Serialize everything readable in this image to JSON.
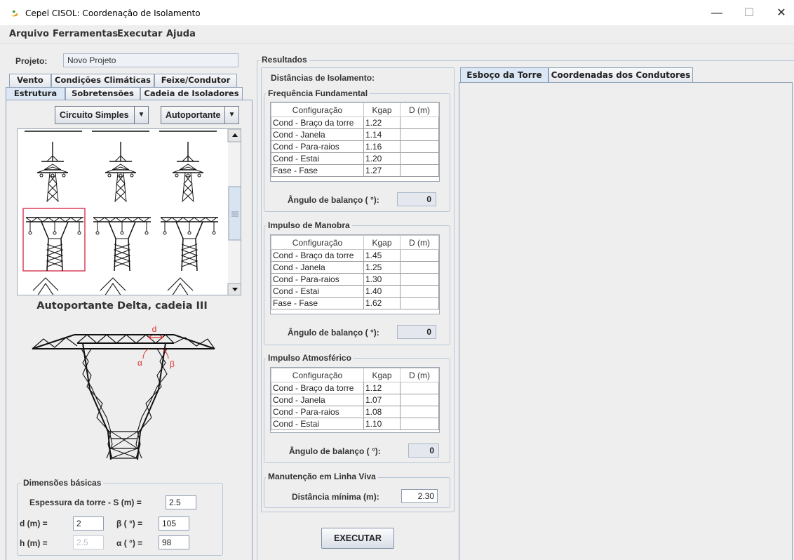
{
  "window": {
    "title": "Cepel CISOL: Coordenação de Isolamento",
    "minimize": "—",
    "maximize": "☐",
    "close": "✕"
  },
  "menu": [
    "Arquivo",
    "Ferramentas",
    "Executar",
    "Ajuda"
  ],
  "project": {
    "label": "Projeto:",
    "value": "Novo Projeto"
  },
  "left_tabs": {
    "row1": [
      "Vento",
      "Condições Climáticas",
      "Feixe/Condutor"
    ],
    "row2": [
      "Estrutura",
      "Sobretensões",
      "Cadeia de Isoladores"
    ],
    "active": "Estrutura"
  },
  "combos": {
    "circuit": "Circuito Simples",
    "type": "Autoportante"
  },
  "selected_structure": "Autoportante Delta, cadeia III",
  "diagram_labels": {
    "d": "d",
    "alpha": "α",
    "beta": "β"
  },
  "dims": {
    "title": "Dimensões básicas",
    "thickness_label": "Espessura da torre - S (m) =",
    "thickness_value": "2.5",
    "d_label": "d (m) =",
    "d_value": "2",
    "beta_label": "β ( °) =",
    "beta_value": "105",
    "h_label": "h (m) =",
    "h_value": "2.5",
    "alpha_label": "α ( °) =",
    "alpha_value": "98"
  },
  "results": {
    "title": "Resultados",
    "subtitle": "Distâncias de Isolamento:",
    "headers": [
      "Configuração",
      "Kgap",
      "D (m)"
    ],
    "angle_label": "Ângulo de balanço ( °):",
    "freq": {
      "title": "Frequência Fundamental",
      "rows": [
        [
          "Cond - Braço da torre",
          "1.22",
          ""
        ],
        [
          "Cond - Janela",
          "1.14",
          ""
        ],
        [
          "Cond - Para-raios",
          "1.16",
          ""
        ],
        [
          "Cond - Estai",
          "1.20",
          ""
        ],
        [
          "Fase - Fase",
          "1.27",
          ""
        ]
      ],
      "angle": "0"
    },
    "manobra": {
      "title": "Impulso de Manobra",
      "rows": [
        [
          "Cond - Braço da torre",
          "1.45",
          ""
        ],
        [
          "Cond - Janela",
          "1.25",
          ""
        ],
        [
          "Cond - Para-raios",
          "1.30",
          ""
        ],
        [
          "Cond - Estai",
          "1.40",
          ""
        ],
        [
          "Fase - Fase",
          "1.62",
          ""
        ]
      ],
      "angle": "0"
    },
    "atmosferico": {
      "title": "Impulso Atmosférico",
      "rows": [
        [
          "Cond - Braço da torre",
          "1.12",
          ""
        ],
        [
          "Cond - Janela",
          "1.07",
          ""
        ],
        [
          "Cond - Para-raios",
          "1.08",
          ""
        ],
        [
          "Cond - Estai",
          "1.10",
          ""
        ]
      ],
      "angle": "0"
    },
    "linha_viva": {
      "title": "Manutenção em Linha Viva",
      "label": "Distância mínima (m):",
      "value": "2.30"
    },
    "execute": "EXECUTAR"
  },
  "right_tabs": [
    "Esboço da Torre",
    "Coordenadas dos Condutores"
  ],
  "colors": {
    "accent": "#dbe7f5",
    "selection": "#d9415a",
    "diagram_red": "#e0322e"
  }
}
